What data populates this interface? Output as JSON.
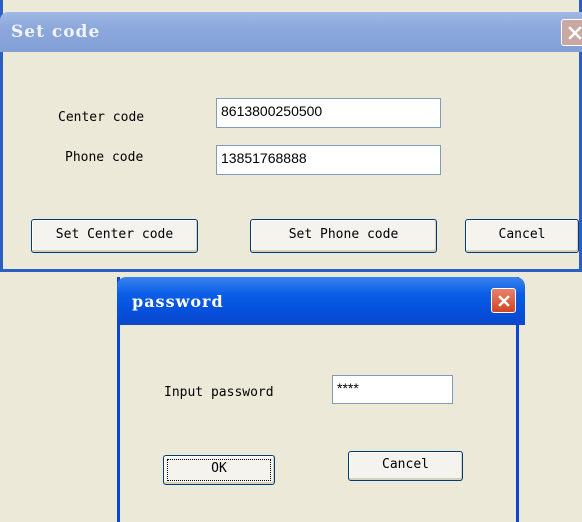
{
  "set_code_dialog": {
    "title": "Set code",
    "close_icon": "close-icon",
    "center_code_label": "Center code",
    "center_code_value": "8613800250500",
    "phone_code_label": "Phone code",
    "phone_code_value": "13851768888",
    "set_center_button": "Set Center code",
    "set_phone_button": "Set Phone code",
    "cancel_button": "Cancel"
  },
  "password_dialog": {
    "title": "password",
    "close_icon": "close-icon",
    "input_label": "Input password",
    "password_value": "****",
    "ok_button": "OK",
    "cancel_button": "Cancel"
  },
  "colors": {
    "inactive_titlebar": "#8ca8dc",
    "active_titlebar": "#0550dc",
    "dialog_face": "#ece9d8"
  }
}
